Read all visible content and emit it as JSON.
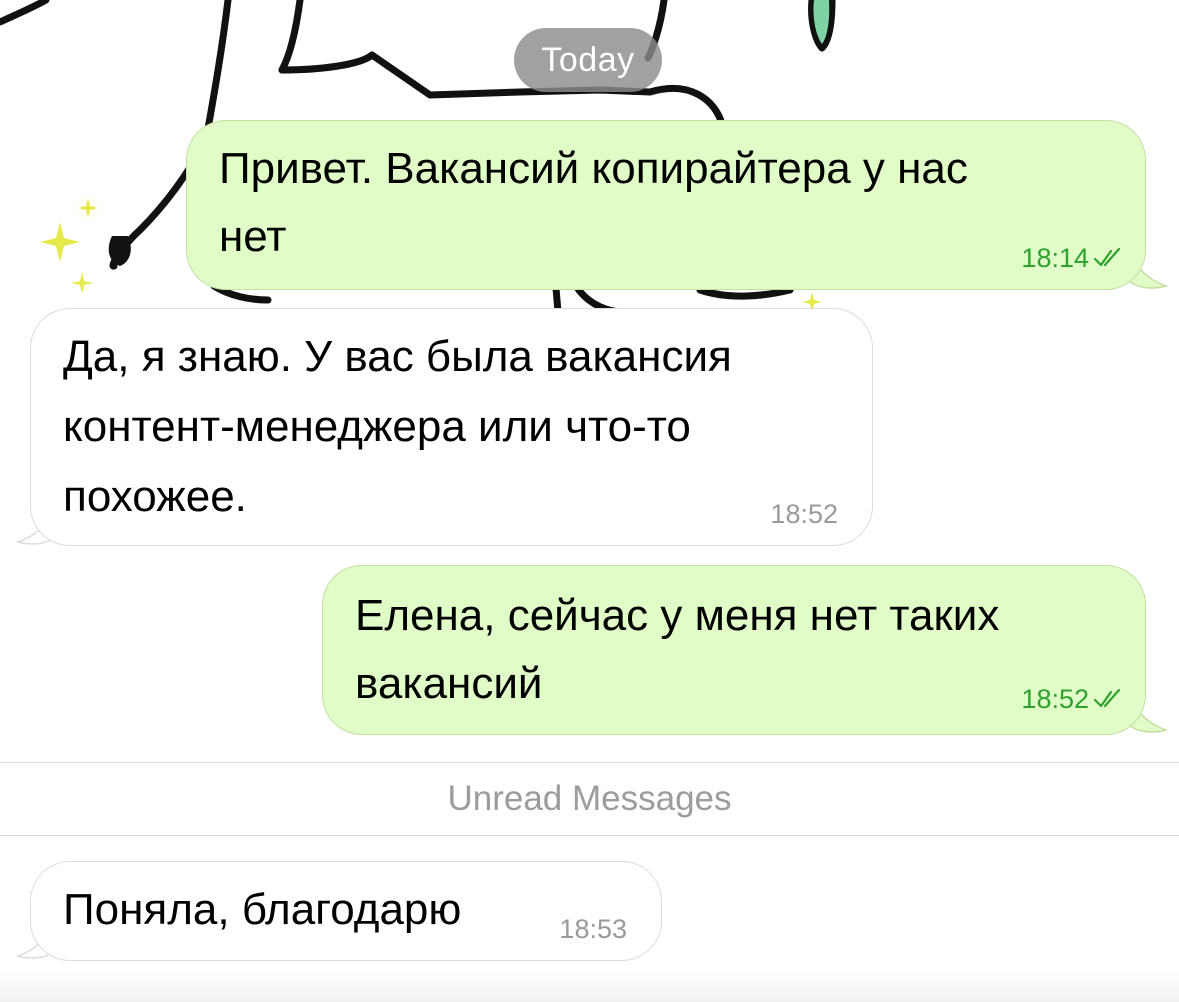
{
  "chat": {
    "date_label": "Today",
    "unread_divider": "Unread Messages",
    "messages": [
      {
        "direction": "outgoing",
        "text_lines": [
          "Привет. Вакансий копирайтера у нас",
          "нет"
        ],
        "time": "18:14",
        "status_icon": "double-check-read-icon"
      },
      {
        "direction": "incoming",
        "text_lines": [
          "Да, я знаю. У вас была вакансия",
          "контент-менеджера или что-то",
          "похожее."
        ],
        "time": "18:52"
      },
      {
        "direction": "outgoing",
        "text_lines": [
          "Елена, сейчас у меня нет таких",
          "вакансий"
        ],
        "time": "18:52",
        "status_icon": "double-check-read-icon"
      },
      {
        "direction": "incoming",
        "text_lines": [
          "Поняла, благодарю"
        ],
        "time": "18:53"
      }
    ]
  },
  "colors": {
    "outgoing_bubble": "#e1fdc7",
    "incoming_bubble": "#ffffff",
    "outgoing_meta": "#2ea22e",
    "incoming_meta": "#9a9a9a",
    "date_pill": "#8c8c8c"
  }
}
